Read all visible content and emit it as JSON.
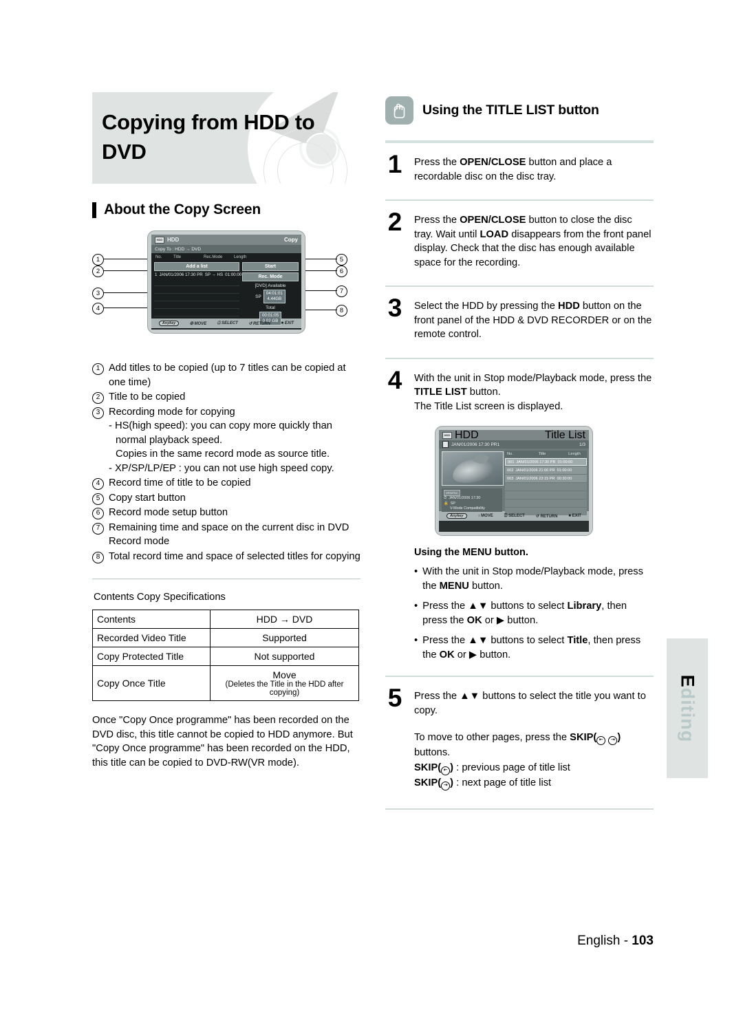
{
  "page": {
    "title": "Copying from HDD to DVD",
    "footer_language": "English - ",
    "footer_page": "103",
    "side_tab": "Editing"
  },
  "left": {
    "section_heading": "About the Copy Screen",
    "copy_screen": {
      "device": "HDD",
      "mode": "Copy",
      "subtitle": "Copy To : HDD → DVD",
      "columns": [
        "No.",
        "Title",
        "Rec.Mode",
        "Length"
      ],
      "add_list_label": "Add a list",
      "row": {
        "no": "1",
        "title": "JAN/01/2006 17:30 PR",
        "recmode": "SP → HS",
        "length": "01:00:00"
      },
      "start_button": "Start",
      "recmode_button": "Rec. Mode",
      "available_label": "[DVD] Available",
      "available_mode": "SP",
      "available_time": "04:01:01",
      "available_size": "4.44GB",
      "total_label": "Total",
      "total_time": "00:01:05",
      "total_size": "0.02 GB",
      "footbar": [
        "Anykey",
        "MOVE",
        "SELECT",
        "RETURN",
        "EXIT"
      ],
      "callouts": [
        "1",
        "2",
        "3",
        "4",
        "5",
        "6",
        "7",
        "8"
      ]
    },
    "legend": [
      {
        "n": "1",
        "lines": [
          "Add titles to be copied (up to 7 titles can be copied at one time)"
        ]
      },
      {
        "n": "2",
        "lines": [
          "Title to be copied"
        ]
      },
      {
        "n": "3",
        "lines": [
          "Recording mode for copying"
        ],
        "subs": [
          "- HS(high speed): you can copy more quickly than normal playback speed.",
          "Copies in the same record mode as source title.",
          "- XP/SP/LP/EP : you can not use high speed copy."
        ]
      },
      {
        "n": "4",
        "lines": [
          "Record time of title to be copied"
        ]
      },
      {
        "n": "5",
        "lines": [
          "Copy start button"
        ]
      },
      {
        "n": "6",
        "lines": [
          "Record mode setup button"
        ]
      },
      {
        "n": "7",
        "lines": [
          "Remaining time and space on the current disc in DVD Record mode"
        ]
      },
      {
        "n": "8",
        "lines": [
          "Total record time and space of selected titles for copying"
        ]
      }
    ],
    "spec_title": "Contents Copy Specifications",
    "spec_table": {
      "headers": [
        "Contents",
        "HDD → DVD"
      ],
      "rows": [
        {
          "label": "Recorded Video Title",
          "value": "Supported",
          "note": ""
        },
        {
          "label": "Copy Protected Title",
          "value": "Not supported",
          "note": ""
        },
        {
          "label": "Copy Once Title",
          "value": "Move",
          "note": "(Deletes the Title in the HDD after copying)"
        }
      ]
    },
    "closing_paragraph": "Once \"Copy Once programme\" has been recorded on the DVD disc, this title cannot be copied to HDD anymore. But \"Copy Once programme\" has been recorded on the HDD, this title can be copied to DVD-RW(VR mode)."
  },
  "right": {
    "heading": "Using the TITLE LIST button",
    "steps": [
      {
        "n": "1",
        "text": "Press the OPEN/CLOSE button and place a recordable disc on the disc tray."
      },
      {
        "n": "2",
        "text": "Press the OPEN/CLOSE button to close the disc tray. Wait until LOAD disappears from the front panel display. Check that the disc has enough available space for the recording."
      },
      {
        "n": "3",
        "text": "Select the HDD by pressing the HDD button on the front panel of the HDD & DVD RECORDER or on the remote control."
      },
      {
        "n": "4",
        "text": "With the unit in Stop mode/Playback mode, press the TITLE LIST button. The Title List screen is displayed."
      },
      {
        "n": "5",
        "text": "Press the ▲▼ buttons to select the title you want to copy."
      }
    ],
    "title_list_screen": {
      "device": "HDD",
      "mode": "Title List",
      "current_title": "JAN/01/2006 17:30 PR1",
      "page_indicator": "1/3",
      "columns": [
        "No.",
        "Title",
        "Length"
      ],
      "rows": [
        {
          "no": "001",
          "title": "JAN/01/2006 17:30 PR",
          "length": "01:00:00",
          "selected": true
        },
        {
          "no": "002",
          "title": "JAN/01/2006 21:00 PR",
          "length": "01:00:00",
          "selected": false
        },
        {
          "no": "003",
          "title": "JAN/01/2006 23:15 PR",
          "length": "00:30:00",
          "selected": false
        }
      ],
      "info_badge": "VPS/PDC",
      "info_date": "JAN/01/2006 17:30",
      "info_mode": "SP",
      "info_vmode": "V-Mode Compatibility",
      "footbar": [
        "Anykey",
        "MOVE",
        "SELECT",
        "RETURN",
        "EXIT"
      ]
    },
    "menu_subhead": "Using the MENU button.",
    "menu_bullets": [
      "With the unit in Stop mode/Playback mode, press the MENU button.",
      "Press the ▲▼ buttons to select Library, then press the OK or ▶ button.",
      "Press the ▲▼ buttons to select Title, then press the OK or ▶ button."
    ],
    "step5_extra": [
      "To move to other pages, press the SKIP(  ) buttons.",
      "SKIP( ) : previous page of title list",
      "SKIP( ) : next page of title list"
    ]
  }
}
